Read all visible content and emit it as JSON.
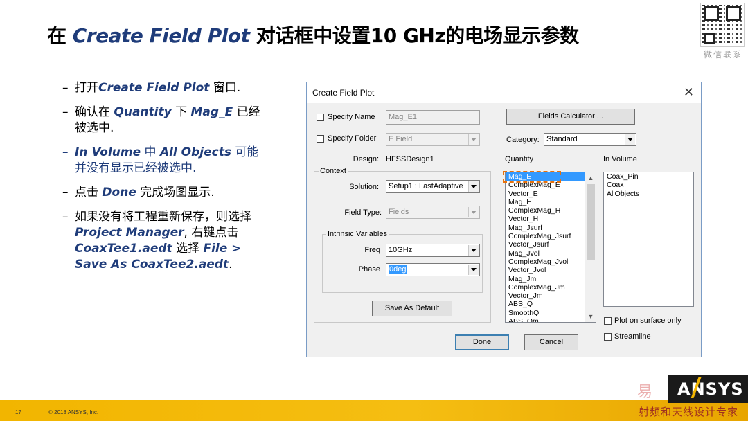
{
  "slide": {
    "title_prefix": "在 ",
    "title_highlight": "Create Field Plot",
    "title_suffix": " 对话框中设置10 GHz的电场显示参数",
    "qr_label": "微信联系"
  },
  "bullets": [
    {
      "dash": "–",
      "t1": "打开",
      "e1": "Create Field Plot",
      "t2": " 窗口."
    },
    {
      "dash": "–",
      "t1": " 确认在 ",
      "e1": "Quantity",
      "t2": " 下 ",
      "e2": "Mag_E",
      "t3": " 已经被选中."
    },
    {
      "dash": "–",
      "e1": "In Volume",
      "t1": " 中 ",
      "e2": "All Objects",
      "t2": " 可能并没有显示已经被选中."
    },
    {
      "dash": "–",
      "t1": "点击 ",
      "e1": "Done",
      "t2": " 完成场图显示."
    },
    {
      "dash": "–",
      "t1": "如果没有将工程重新保存，则选择 ",
      "e1": "Project Manager",
      "t2": ", 右键点击",
      "e2": "CoaxTee1.aedt",
      "t3": " 选择 ",
      "e3": "File > Save As CoaxTee2.aedt",
      "t4": "."
    }
  ],
  "dialog": {
    "title": "Create Field Plot",
    "close": "✕",
    "specify_name_label": "Specify Name",
    "specify_name_value": "Mag_E1",
    "specify_folder_label": "Specify Folder",
    "specify_folder_value": "E Field",
    "design_label": "Design:",
    "design_value": "HFSSDesign1",
    "context_label": "Context",
    "solution_label": "Solution:",
    "solution_value": "Setup1 : LastAdaptive",
    "field_type_label": "Field Type:",
    "field_type_value": "Fields",
    "intrinsic_label": "Intrinsic Variables",
    "freq_label": "Freq",
    "freq_value": "10GHz",
    "phase_label": "Phase",
    "phase_value": "0deg",
    "save_default": "Save As Default",
    "fields_calculator": "Fields Calculator ...",
    "category_label": "Category:",
    "category_value": "Standard",
    "quantity_label": "Quantity",
    "in_volume_label": "In Volume",
    "quantities": [
      "Mag_E",
      "ComplexMag_E",
      "Vector_E",
      "Mag_H",
      "ComplexMag_H",
      "Vector_H",
      "Mag_Jsurf",
      "ComplexMag_Jsurf",
      "Vector_Jsurf",
      "Mag_Jvol",
      "ComplexMag_Jvol",
      "Vector_Jvol",
      "Mag_Jm",
      "ComplexMag_Jm",
      "Vector_Jm",
      "ABS_Q",
      "SmoothQ",
      "ABS_Qm"
    ],
    "volumes": [
      "Coax_Pin",
      "Coax",
      "AllObjects"
    ],
    "plot_on_surface": "Plot on surface only",
    "streamline": "Streamline",
    "done": "Done",
    "cancel": "Cancel"
  },
  "footer": {
    "page": "17",
    "copyright": "© 2018 ANSYS, Inc.",
    "logo": "ANSYS",
    "watermark_top": "易",
    "watermark_bottom": "射频和天线设计专家"
  }
}
